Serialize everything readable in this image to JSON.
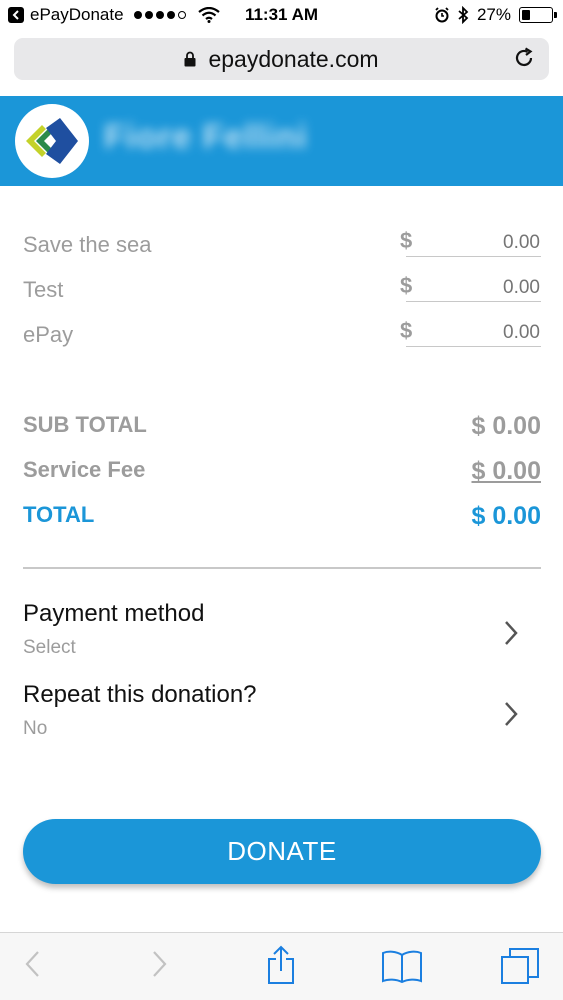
{
  "status_bar": {
    "app": "ePayDonate",
    "time": "11:31 AM",
    "battery": "27%"
  },
  "browser": {
    "url": "epaydonate.com"
  },
  "header": {
    "org_name": "Fiore Fellini",
    "brand_color": "#1b96d8"
  },
  "donations": [
    {
      "label": "Save the sea",
      "currency": "$",
      "placeholder": "0.00"
    },
    {
      "label": "Test",
      "currency": "$",
      "placeholder": "0.00"
    },
    {
      "label": "ePay",
      "currency": "$",
      "placeholder": "0.00"
    }
  ],
  "totals": {
    "sub_total_label": "SUB TOTAL",
    "sub_total_value": "$ 0.00",
    "service_fee_label": "Service Fee",
    "service_fee_value": "$ 0.00",
    "total_label": "TOTAL",
    "total_value": "$ 0.00"
  },
  "options": {
    "payment_method": {
      "title": "Payment method",
      "value": "Select"
    },
    "repeat_donation": {
      "title": "Repeat this donation?",
      "value": "No"
    }
  },
  "donate_button": "DONATE",
  "toolbar_icons": [
    "back-icon",
    "forward-icon",
    "share-icon",
    "bookmarks-icon",
    "tabs-icon"
  ]
}
